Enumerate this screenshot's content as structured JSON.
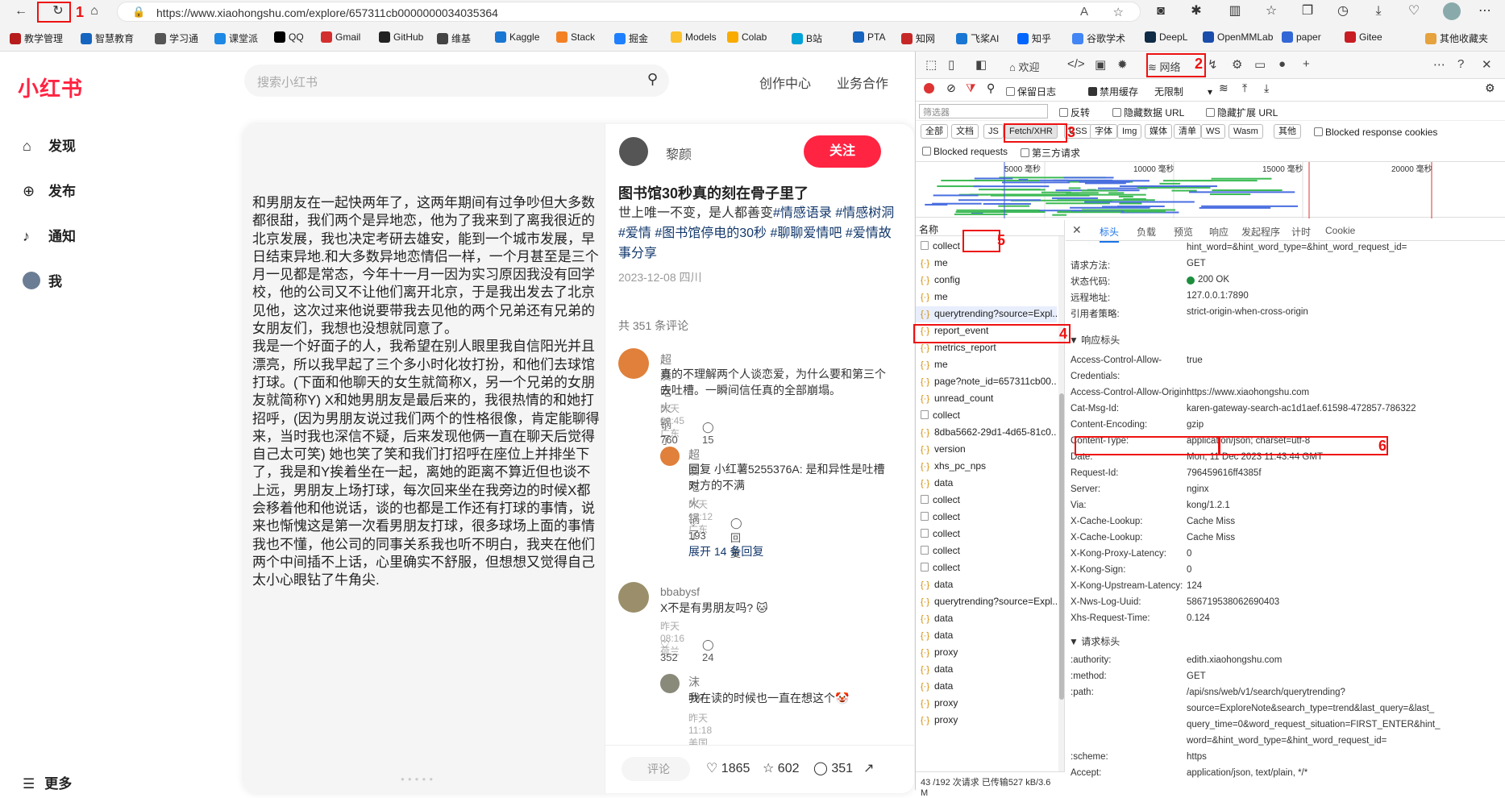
{
  "browser": {
    "url": "https://www.xiaohongshu.com/explore/657311cb0000000034035364",
    "annotations": [
      "1",
      "2",
      "3",
      "4",
      "5",
      "6"
    ],
    "bookmarks": [
      "教学管理",
      "智慧教育",
      "学习通",
      "课堂派",
      "QQ",
      "Gmail",
      "GitHub",
      "维基",
      "Kaggle",
      "Stack",
      "掘金",
      "Models",
      "Colab",
      "B站",
      "PTA",
      "知网",
      "飞桨AI",
      "知乎",
      "谷歌学术",
      "DeepL",
      "OpenMMLab",
      "paper",
      "Gitee",
      "其他收藏夹"
    ],
    "bookmark_colors": [
      "#b71c1c",
      "#1565c0",
      "#555",
      "#1e88e5",
      "#000",
      "#d32f2f",
      "#222",
      "#444",
      "#1976d2",
      "#f48024",
      "#1e80ff",
      "#fbc02d",
      "#f9ab00",
      "#00a1d6",
      "#1565c0",
      "#c62828",
      "#1976d2",
      "#0066ff",
      "#4285f4",
      "#0f2b46",
      "#1a4dab",
      "#3367d6",
      "#c71d23",
      "#e6a23c"
    ]
  },
  "site": {
    "logo": "小红书",
    "search_placeholder": "搜索小红书",
    "nav_creator": "创作中心",
    "nav_business": "业务合作",
    "side": {
      "discover": "发现",
      "publish": "发布",
      "notify": "通知",
      "me": "我",
      "more": "更多"
    }
  },
  "note": {
    "body": "和男朋友在一起快两年了，这两年期间有过争吵但大多数都很甜，我们两个是异地恋，他为了我来到了离我很近的北京发展，我也决定考研去雄安，能到一个城市发展，早日结束异地.和大多数异地恋情侣一样，一个月甚至是三个月一见都是常态，今年十一月一因为实习原因我没有回学校，他的公司又不让他们离开北京，于是我出发去了北京见他，这次过来他说要带我去见他的两个兄弟还有兄弟的女朋友们，我想也没想就同意了。\n我是一个好面子的人，我希望在别人眼里我自信阳光并且漂亮，所以我早起了三个多小时化妆打扮，和他们去球馆打球。(下面和他聊天的女生就简称X，另一个兄弟的女朋友就简称Y) X和她男朋友是最后来的，我很热情的和她打招呼，(因为男朋友说过我们两个的性格很像，肯定能聊得来，当时我也深信不疑，后来发现他俩一直在聊天后觉得自己太可笑) 她也笑了笑和我们打招呼在座位上并排坐下了，我是和Y挨着坐在一起，离她的距离不算近但也谈不上远，男朋友上场打球，每次回来坐在我旁边的时候X都会移着他和他说话，谈的也都是工作还有打球的事情，说来也惭愧这是第一次看男朋友打球，很多球场上面的事情我也不懂，他公司的同事关系我也听不明白，我夹在他们两个中间插不上话，心里确实不舒服，但想想又觉得自己太小心眼钻了牛角尖.",
    "author": "黎颜",
    "follow": "关注",
    "title": "图书馆30秒真的刻在骨子里了",
    "desc_plain": "世上唯一不变，是人都善变",
    "desc_tags": "#情感语录 #情感树洞 #爱情 #图书馆停电的30秒 #聊聊爱情吧 #爱情故事分享",
    "date": "2023-12-08 四川",
    "comment_count": "共 351 条评论",
    "comments": [
      {
        "name": "超爱吃火锅了",
        "text": "真的不理解两个人谈恋爱，为什么要和第三个去吐槽。一瞬间信任真的全部崩塌。",
        "meta": "昨天 06:45 广东",
        "likes": "♡ 760",
        "replies": "◯ 15"
      },
      {
        "name": "超爱吃火锅了",
        "text": "回复 小红薯5255376A: 是和异性是吐槽对方的不满",
        "meta": "昨天 14:12 广东",
        "likes": "♡ 193",
        "replies": "◯ 回复"
      },
      {
        "name": "bbabysf",
        "text": "X不是有男朋友吗? 🐱",
        "meta": "昨天 08:16 荷兰",
        "likes": "♡ 352",
        "replies": "◯ 24"
      },
      {
        "name": "沫mo",
        "text": "我在读的时候也一直在想这个🤡",
        "meta": "昨天 11:18 美国"
      }
    ],
    "expand": "展开 14 条回复",
    "input_placeholder": "评论",
    "stats": {
      "likes": "1865",
      "stars": "602",
      "comments": "351"
    }
  },
  "devtools": {
    "tabs": {
      "welcome": "欢迎",
      "network": "网络"
    },
    "options": {
      "preserve_log": "保留日志",
      "disable_cache": "禁用缓存",
      "throttle": "无限制"
    },
    "filter_placeholder": "筛选器",
    "filter_opts": [
      "反转",
      "隐藏数据 URL",
      "隐藏扩展 URL"
    ],
    "types": [
      "全部",
      "文档",
      "JS",
      "Fetch/XHR",
      "CSS",
      "字体",
      "Img",
      "媒体",
      "清单",
      "WS",
      "Wasm",
      "其他"
    ],
    "blocked_cookies": "Blocked response cookies",
    "blocked_requests": "Blocked requests",
    "third_party": "第三方请求",
    "timeline_labels": [
      "5000 毫秒",
      "10000 毫秒",
      "15000 毫秒",
      "20000 毫秒"
    ],
    "list_header": "名称",
    "requests": [
      {
        "name": "collect",
        "fx": false
      },
      {
        "name": "me",
        "fx": true
      },
      {
        "name": "config",
        "fx": true
      },
      {
        "name": "me",
        "fx": true
      },
      {
        "name": "querytrending?source=Expl...",
        "fx": true
      },
      {
        "name": "report_event",
        "fx": true
      },
      {
        "name": "metrics_report",
        "fx": true
      },
      {
        "name": "me",
        "fx": true
      },
      {
        "name": "page?note_id=657311cb00...",
        "fx": true
      },
      {
        "name": "unread_count",
        "fx": true
      },
      {
        "name": "collect",
        "fx": false
      },
      {
        "name": "8dba5662-29d1-4d65-81c0...",
        "fx": true
      },
      {
        "name": "version",
        "fx": true
      },
      {
        "name": "xhs_pc_nps",
        "fx": true
      },
      {
        "name": "data",
        "fx": true
      },
      {
        "name": "collect",
        "fx": false
      },
      {
        "name": "collect",
        "fx": false
      },
      {
        "name": "collect",
        "fx": false
      },
      {
        "name": "collect",
        "fx": false
      },
      {
        "name": "collect",
        "fx": false
      },
      {
        "name": "data",
        "fx": true
      },
      {
        "name": "querytrending?source=Expl...",
        "fx": true
      },
      {
        "name": "data",
        "fx": true
      },
      {
        "name": "data",
        "fx": true
      },
      {
        "name": "proxy",
        "fx": true
      },
      {
        "name": "data",
        "fx": true
      },
      {
        "name": "data",
        "fx": true
      },
      {
        "name": "proxy",
        "fx": true
      },
      {
        "name": "proxy",
        "fx": true
      }
    ],
    "status": "43 /192 次请求  已传输527 kB/3.6 M",
    "detail_tabs": [
      "标头",
      "负载",
      "预览",
      "响应",
      "发起程序",
      "计时",
      "Cookie"
    ],
    "general_cut": "hint_word=&hint_word_type=&hint_word_request_id=",
    "general": [
      {
        "k": "请求方法:",
        "v": "GET"
      },
      {
        "k": "状态代码:",
        "v": "200 OK"
      },
      {
        "k": "远程地址:",
        "v": "127.0.0.1:7890"
      },
      {
        "k": "引用者策略:",
        "v": "strict-origin-when-cross-origin"
      }
    ],
    "resp_section": "▼ 响应标头",
    "resp_headers": [
      {
        "k": "Access-Control-Allow-",
        "v": "true"
      },
      {
        "k": "Credentials:",
        "v": ""
      },
      {
        "k": "Access-Control-Allow-Origin:",
        "v": "https://www.xiaohongshu.com"
      },
      {
        "k": "Cat-Msg-Id:",
        "v": "karen-gateway-search-ac1d1aef.61598-472857-786322"
      },
      {
        "k": "Content-Encoding:",
        "v": "gzip"
      },
      {
        "k": "Content-Type:",
        "v": "application/json; charset=utf-8"
      },
      {
        "k": "Date:",
        "v": "Mon, 11 Dec 2023 11:43:44 GMT"
      },
      {
        "k": "Request-Id:",
        "v": "796459616ff4385f"
      },
      {
        "k": "Server:",
        "v": "nginx"
      },
      {
        "k": "Via:",
        "v": "kong/1.2.1"
      },
      {
        "k": "X-Cache-Lookup:",
        "v": "Cache Miss"
      },
      {
        "k": "X-Cache-Lookup:",
        "v": "Cache Miss"
      },
      {
        "k": "X-Kong-Proxy-Latency:",
        "v": "0"
      },
      {
        "k": "X-Kong-Sign:",
        "v": "0"
      },
      {
        "k": "X-Kong-Upstream-Latency:",
        "v": "124"
      },
      {
        "k": "X-Nws-Log-Uuid:",
        "v": "586719538062690403"
      },
      {
        "k": "Xhs-Request-Time:",
        "v": "0.124"
      }
    ],
    "req_section": "▼ 请求标头",
    "req_headers": [
      {
        "k": ":authority:",
        "v": "edith.xiaohongshu.com"
      },
      {
        "k": ":method:",
        "v": "GET"
      },
      {
        "k": ":path:",
        "v": "/api/sns/web/v1/search/querytrending?"
      },
      {
        "k": "",
        "v": "source=ExploreNote&search_type=trend&last_query=&last_"
      },
      {
        "k": "",
        "v": "query_time=0&word_request_situation=FIRST_ENTER&hint_"
      },
      {
        "k": "",
        "v": "word=&hint_word_type=&hint_word_request_id="
      },
      {
        "k": ":scheme:",
        "v": "https"
      },
      {
        "k": "Accept:",
        "v": "application/json, text/plain, */*"
      }
    ]
  }
}
